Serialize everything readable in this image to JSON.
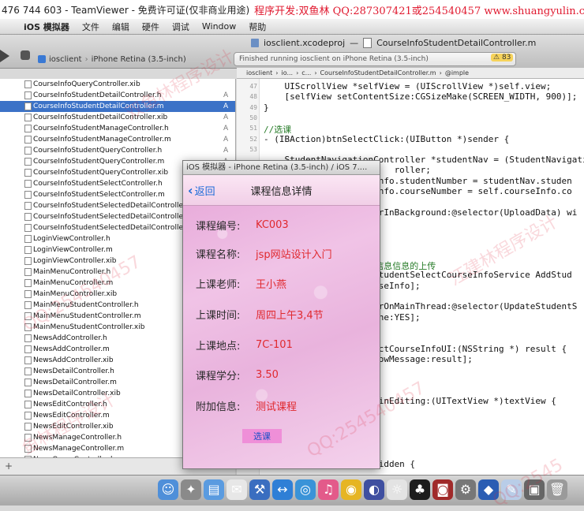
{
  "teamviewer": {
    "title": "476 744 603 - TeamViewer - 免费许可证(仅非商业用途)",
    "ad": "程序开发:双鱼林 QQ:287307421或254540457 www.shuangyulin.com"
  },
  "menubar": {
    "app": "iOS 模拟器",
    "items": [
      "文件",
      "编辑",
      "硬件",
      "调试",
      "Window",
      "帮助"
    ]
  },
  "toolbar": {
    "scheme": "iosclient",
    "device": "iPhone Retina (3.5-inch)",
    "project_tab": "iosclient.xcodeproj",
    "file_tab": "CourseInfoStudentDetailController.m",
    "status": "Finished running iosclient on iPhone Retina (3.5-inch)",
    "warnings": "83"
  },
  "navigator": {
    "files": [
      {
        "name": "CourseInfoQueryController.xib",
        "badge": ""
      },
      {
        "name": "CourseInfoStudentDetailController.h",
        "badge": "A"
      },
      {
        "name": "CourseInfoStudentDetailController.m",
        "badge": "A",
        "selected": true
      },
      {
        "name": "CourseInfoStudentDetailController.xib",
        "badge": "A"
      },
      {
        "name": "CourseInfoStudentManageController.h",
        "badge": "A"
      },
      {
        "name": "CourseInfoStudentManageController.m",
        "badge": "A"
      },
      {
        "name": "CourseInfoStudentQueryController.h",
        "badge": "A"
      },
      {
        "name": "CourseInfoStudentQueryController.m",
        "badge": "A"
      },
      {
        "name": "CourseInfoStudentQueryController.xib",
        "badge": "A"
      },
      {
        "name": "CourseInfoStudentSelectController.h",
        "badge": "A"
      },
      {
        "name": "CourseInfoStudentSelectController.m",
        "badge": "A"
      },
      {
        "name": "CourseInfoStudentSelectedDetailController.h",
        "badge": "A"
      },
      {
        "name": "CourseInfoStudentSelectedDetailController.m",
        "badge": "A"
      },
      {
        "name": "CourseInfoStudentSelectedDetailController.xib",
        "badge": "A"
      },
      {
        "name": "LoginViewController.h",
        "badge": ""
      },
      {
        "name": "LoginViewController.m",
        "badge": ""
      },
      {
        "name": "LoginViewController.xib",
        "badge": ""
      },
      {
        "name": "MainMenuController.h",
        "badge": ""
      },
      {
        "name": "MainMenuController.m",
        "badge": ""
      },
      {
        "name": "MainMenuController.xib",
        "badge": ""
      },
      {
        "name": "MainMenuStudentController.h",
        "badge": ""
      },
      {
        "name": "MainMenuStudentController.m",
        "badge": ""
      },
      {
        "name": "MainMenuStudentController.xib",
        "badge": ""
      },
      {
        "name": "NewsAddController.h",
        "badge": ""
      },
      {
        "name": "NewsAddController.m",
        "badge": ""
      },
      {
        "name": "NewsAddController.xib",
        "badge": ""
      },
      {
        "name": "NewsDetailController.h",
        "badge": ""
      },
      {
        "name": "NewsDetailController.m",
        "badge": ""
      },
      {
        "name": "NewsDetailController.xib",
        "badge": ""
      },
      {
        "name": "NewsEditController.h",
        "badge": ""
      },
      {
        "name": "NewsEditController.m",
        "badge": ""
      },
      {
        "name": "NewsEditController.xib",
        "badge": ""
      },
      {
        "name": "NewsManageController.h",
        "badge": ""
      },
      {
        "name": "NewsManageController.m",
        "badge": ""
      },
      {
        "name": "NewsQueryController.h",
        "badge": ""
      }
    ]
  },
  "jumpbar": [
    "iosclient",
    "io...",
    "c...",
    "CourseInfoStudentDetailController.m",
    "@imple"
  ],
  "editor": {
    "line_numbers": [
      "47",
      "48",
      "49",
      "50",
      "51",
      "52",
      "53"
    ],
    "lines": [
      "    UIScrollView *selfView = (UIScrollView *)self.view;",
      "    [selfView setContentSize:CGSizeMake(SCREEN_WIDTH, 900)];",
      "}",
      "",
      "//选课",
      "- (IBAction)btnSelectClick:(UIButton *)sender {",
      "",
      "    StudentNavigationController *studentNav = (StudentNavigati",
      "                         roller;",
      "                  rseInfo.studentNumber = studentNav.studen",
      "                  rseInfo.courseNumber = self.courseInfo.co",
      "",
      "                  ectorInBackground:@selector(UploadData) wi",
      "",
      "",
      "",
      "",
      "                  选课信息信息的上传",
      "                  = [StudentSelectCourseInfoService AddStud",
      "                  CourseInfo];",
      "",
      "                  ectorOnMainThread:@selector(UpdateStudentS",
      "                  ilDone:YES];",
      "",
      "",
      "                  SelectCourseInfoUI:(NSString *) result {",
      "                  t]showMessage:result];",
      "",
      "",
      "",
      "                  dBeginEditing:(UITextView *)textView {",
      "",
      "",
      "",
      "",
      "",
      "                  BarHidden {"
    ]
  },
  "simulator": {
    "window_title": "iOS 模拟器 - iPhone Retina (3.5-inch) / iOS 7....",
    "back": "返回",
    "nav_title": "课程信息详情",
    "fields": [
      {
        "label": "课程编号:",
        "value": "KC003"
      },
      {
        "label": "课程名称:",
        "value": "jsp网站设计入门"
      },
      {
        "label": "上课老师:",
        "value": "王小燕"
      },
      {
        "label": "上课时间:",
        "value": "周四上午3,4节"
      },
      {
        "label": "上课地点:",
        "value": "7C-101"
      },
      {
        "label": "课程学分:",
        "value": "3.50"
      },
      {
        "label": "附加信息:",
        "value": "测试课程"
      }
    ],
    "select_button": "选课"
  },
  "dock": {
    "icons": [
      "finder-icon",
      "launchpad-icon",
      "folder-icon",
      "mail-icon",
      "xcode-icon",
      "teamviewer-icon",
      "safari-icon",
      "itunes-icon",
      "chrome-icon",
      "eclipse-icon",
      "weather-icon",
      "qq-icon",
      "photobooth-icon",
      "preferences-icon",
      "app-icon",
      "textedit-icon",
      "app2-icon",
      "trash-icon"
    ]
  },
  "watermarks": [
    "QQ:254540457",
    "双鱼林程序设计",
    "汪建林程序设计",
    "QQ:254540457",
    "鱼林程序设计",
    "QQ:2545"
  ]
}
